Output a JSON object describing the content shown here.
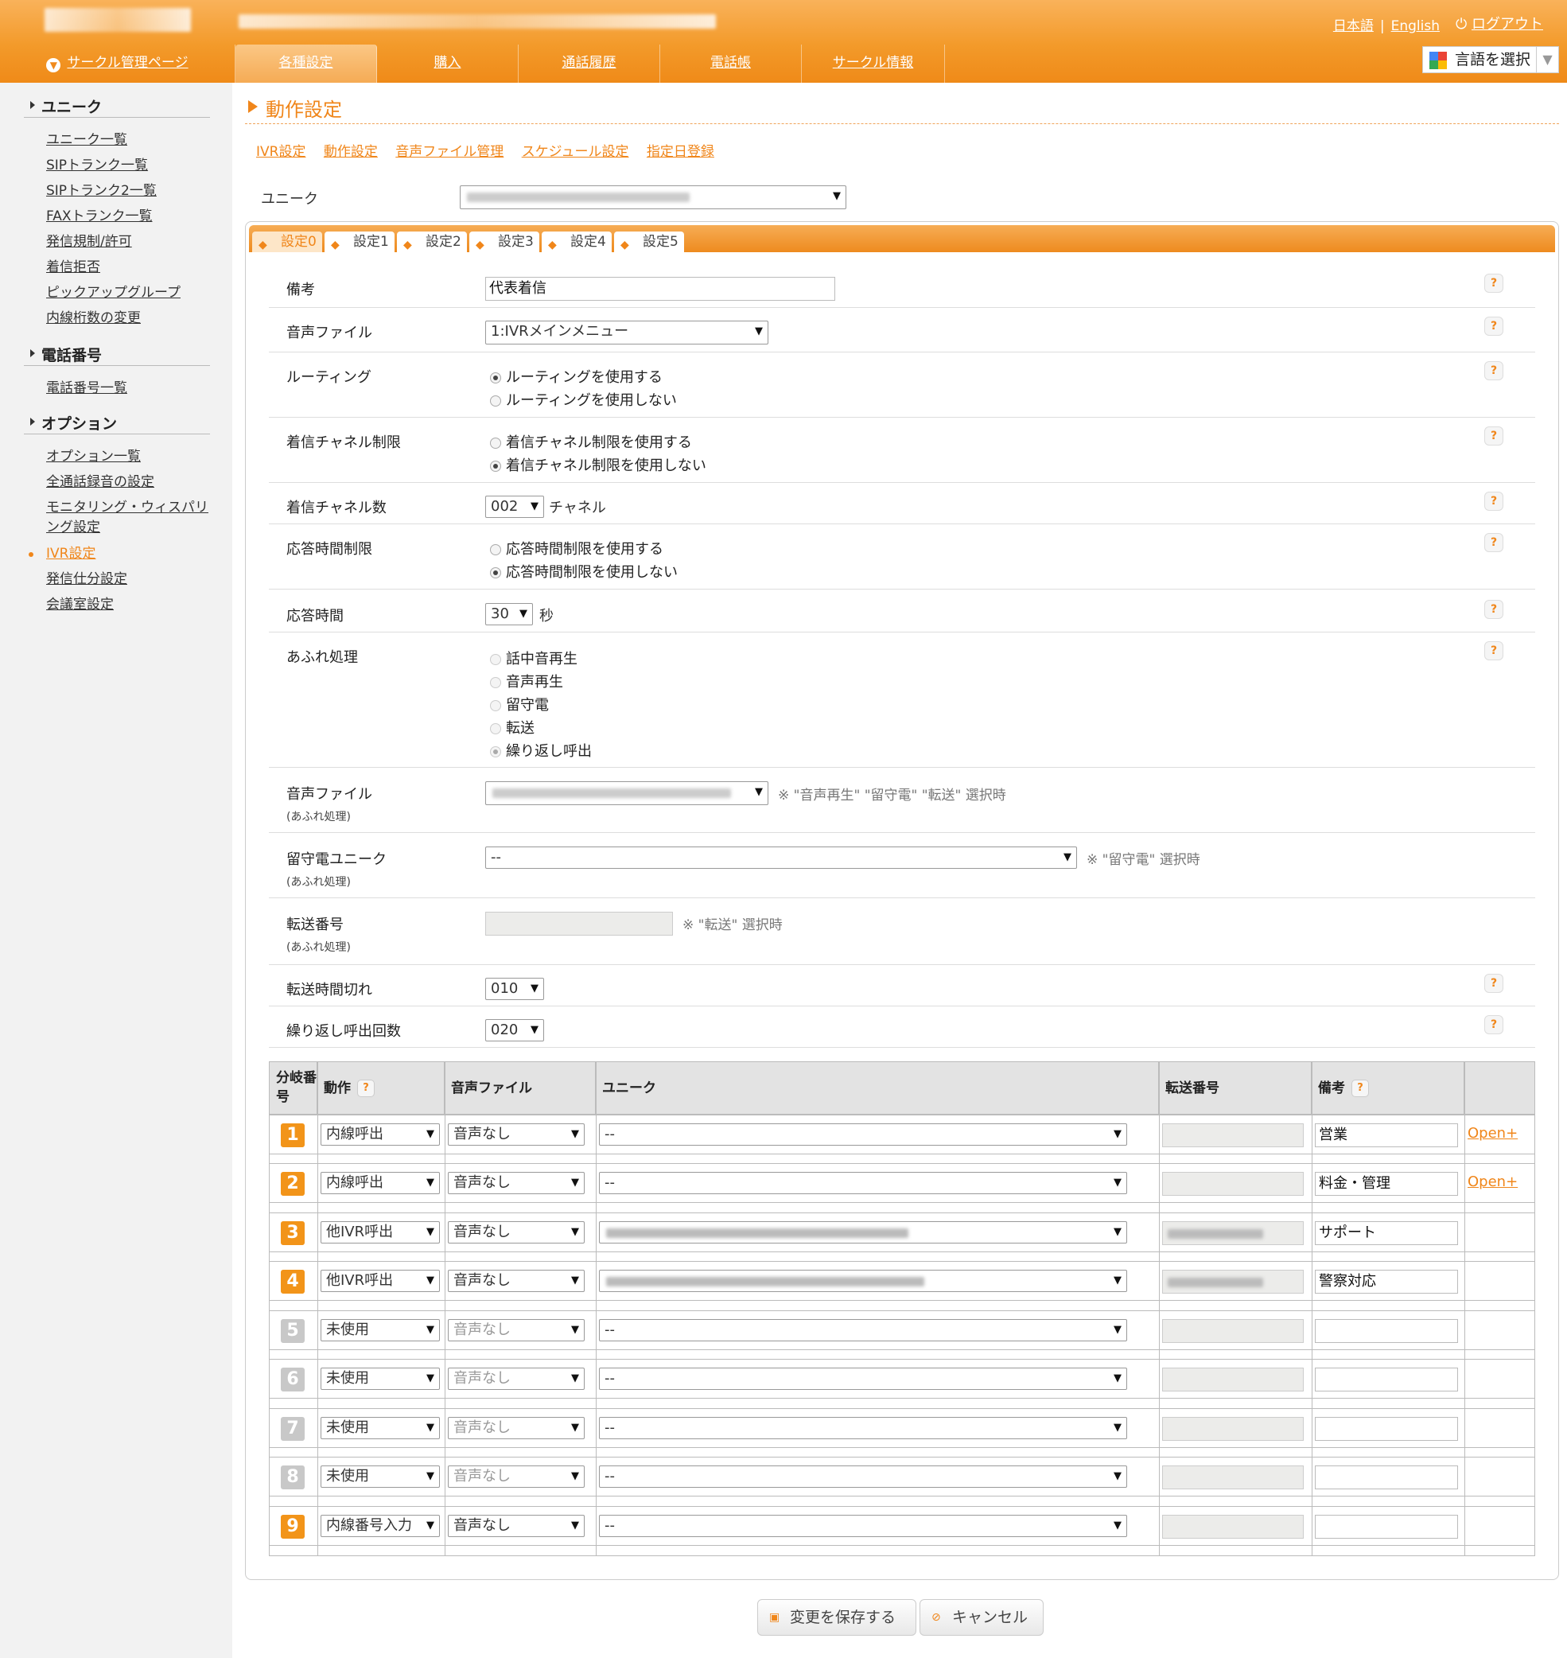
{
  "header": {
    "lang_ja": "日本語",
    "lang_en": "English",
    "logout": "ログアウト",
    "circle_home": "サークル管理ページ",
    "nav": [
      {
        "label": "各種設定",
        "active": true
      },
      {
        "label": "購入",
        "active": false
      },
      {
        "label": "通話履歴",
        "active": false
      },
      {
        "label": "電話帳",
        "active": false
      },
      {
        "label": "サークル情報",
        "active": false
      }
    ],
    "language_select": "言語を選択"
  },
  "sidebar": {
    "section_unique": "ユニーク",
    "unique_links": [
      "ユニーク一覧",
      "SIPトランク一覧",
      "SIPトランク2一覧",
      "FAXトランク一覧",
      "発信規制/許可",
      "着信拒否",
      "ピックアップグループ",
      "内線桁数の変更"
    ],
    "section_phone": "電話番号",
    "phone_links": [
      "電話番号一覧"
    ],
    "section_option": "オプション",
    "option_links": [
      "オプション一覧",
      "全通話録音の設定",
      "モニタリング・ウィスパリング設定",
      "IVR設定",
      "発信仕分設定",
      "会議室設定"
    ],
    "active_link": "IVR設定"
  },
  "main": {
    "title": "動作設定",
    "sub_links": [
      "IVR設定",
      "動作設定",
      "音声ファイル管理",
      "スケジュール設定",
      "指定日登録"
    ],
    "unique_label": "ユニーク",
    "tabs": [
      "設定0",
      "設定1",
      "設定2",
      "設定3",
      "設定4",
      "設定5"
    ],
    "active_tab": "設定0"
  },
  "form": {
    "remark_label": "備考",
    "remark_value": "代表着信",
    "audio_label": "音声ファイル",
    "audio_value": "1:IVRメインメニュー",
    "routing_label": "ルーティング",
    "routing_options": [
      "ルーティングを使用する",
      "ルーティングを使用しない"
    ],
    "routing_selected": 0,
    "channel_limit_label": "着信チャネル制限",
    "channel_limit_options": [
      "着信チャネル制限を使用する",
      "着信チャネル制限を使用しない"
    ],
    "channel_limit_selected": 1,
    "channel_count_label": "着信チャネル数",
    "channel_count_value": "002",
    "channel_unit": "チャネル",
    "answer_limit_label": "応答時間制限",
    "answer_limit_options": [
      "応答時間制限を使用する",
      "応答時間制限を使用しない"
    ],
    "answer_limit_selected": 1,
    "answer_time_label": "応答時間",
    "answer_time_value": "30",
    "answer_time_unit": "秒",
    "overflow_label": "あふれ処理",
    "overflow_options": [
      "話中音再生",
      "音声再生",
      "留守電",
      "転送",
      "繰り返し呼出"
    ],
    "overflow_selected": 4,
    "overflow_audio_label": "音声ファイル",
    "overflow_sub": "(あふれ処理)",
    "overflow_audio_note": "※ \"音声再生\" \"留守電\" \"転送\" 選択時",
    "voicemail_label": "留守電ユニーク",
    "voicemail_value": "--",
    "voicemail_note": "※ \"留守電\" 選択時",
    "transfer_label": "転送番号",
    "transfer_note": "※ \"転送\" 選択時",
    "transfer_timeout_label": "転送時間切れ",
    "transfer_timeout_value": "010",
    "repeat_label": "繰り返し呼出回数",
    "repeat_value": "020",
    "help": "?"
  },
  "table": {
    "headers": {
      "branch": "分岐番号",
      "action": "動作",
      "audio": "音声ファイル",
      "unique": "ユニーク",
      "transfer": "転送番号",
      "remark": "備考"
    },
    "rows": [
      {
        "num": "1",
        "action": "内線呼出",
        "audio": "音声なし",
        "unique": "--",
        "remark": "営業",
        "open": "Open+",
        "active": true
      },
      {
        "num": "2",
        "action": "内線呼出",
        "audio": "音声なし",
        "unique": "--",
        "remark": "料金・管理",
        "open": "Open+",
        "active": true
      },
      {
        "num": "3",
        "action": "他IVR呼出",
        "audio": "音声なし",
        "unique": "",
        "remark": "サポート",
        "open": "",
        "active": true
      },
      {
        "num": "4",
        "action": "他IVR呼出",
        "audio": "音声なし",
        "unique": "",
        "remark": "警察対応",
        "open": "",
        "active": true
      },
      {
        "num": "5",
        "action": "未使用",
        "audio": "音声なし",
        "unique": "--",
        "remark": "",
        "open": "",
        "active": false
      },
      {
        "num": "6",
        "action": "未使用",
        "audio": "音声なし",
        "unique": "--",
        "remark": "",
        "open": "",
        "active": false
      },
      {
        "num": "7",
        "action": "未使用",
        "audio": "音声なし",
        "unique": "--",
        "remark": "",
        "open": "",
        "active": false
      },
      {
        "num": "8",
        "action": "未使用",
        "audio": "音声なし",
        "unique": "--",
        "remark": "",
        "open": "",
        "active": false
      },
      {
        "num": "9",
        "action": "内線番号入力",
        "audio": "音声なし",
        "unique": "--",
        "remark": "",
        "open": "",
        "active": true
      }
    ]
  },
  "buttons": {
    "save": "変更を保存する",
    "cancel": "キャンセル"
  },
  "colors": {
    "accent": "#f0861a",
    "header": "#f39a2a"
  }
}
